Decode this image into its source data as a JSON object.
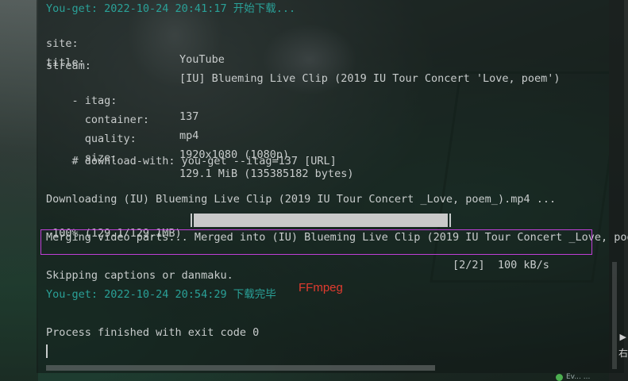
{
  "console": {
    "lines": {
      "start": "You-get: 2022-10-24 20:41:17 开始下载...",
      "site_label": "site:",
      "site_value": "YouTube",
      "title_label": "title:",
      "title_value": "[IU] Blueming Live Clip (2019 IU Tour Concert 'Love, poem')",
      "stream_label": "stream:",
      "itag_label": "    - itag:",
      "itag_value": "137",
      "container_label": "      container:",
      "container_value": "mp4",
      "quality_label": "      quality:",
      "quality_value": "1920x1080 (1080p)",
      "size_label": "      size:",
      "size_value": "129.1 MiB (135385182 bytes)",
      "download_with": "    # download-with: you-get --itag=137 [URL]",
      "downloading": "Downloading (IU) Blueming Live Clip (2019 IU Tour Concert _Love, poem_).mp4 ...",
      "progress_prefix": " 100% (129.1/129.1MB) ",
      "progress_suffix": "[2/2]  100 kB/s",
      "merging": "Merging video parts... Merged into (IU) Blueming Live Clip (2019 IU Tour Concert _Love, poe",
      "skipping": "Skipping captions or danmaku.",
      "finished": "You-get: 2022-10-24 20:54:29 下载完毕",
      "exit": "Process finished with exit code 0"
    },
    "progress_fraction": 1.0
  },
  "annotation": {
    "ffmpeg_label": "FFmpeg"
  },
  "corner": {
    "arrow": "▶",
    "text": "右"
  },
  "status": {
    "text": "Ev... ..."
  },
  "colors": {
    "teal": "#2aa198",
    "text": "#c8cccc",
    "highlight": "#c03fd8",
    "annotation": "#e23b2f"
  }
}
